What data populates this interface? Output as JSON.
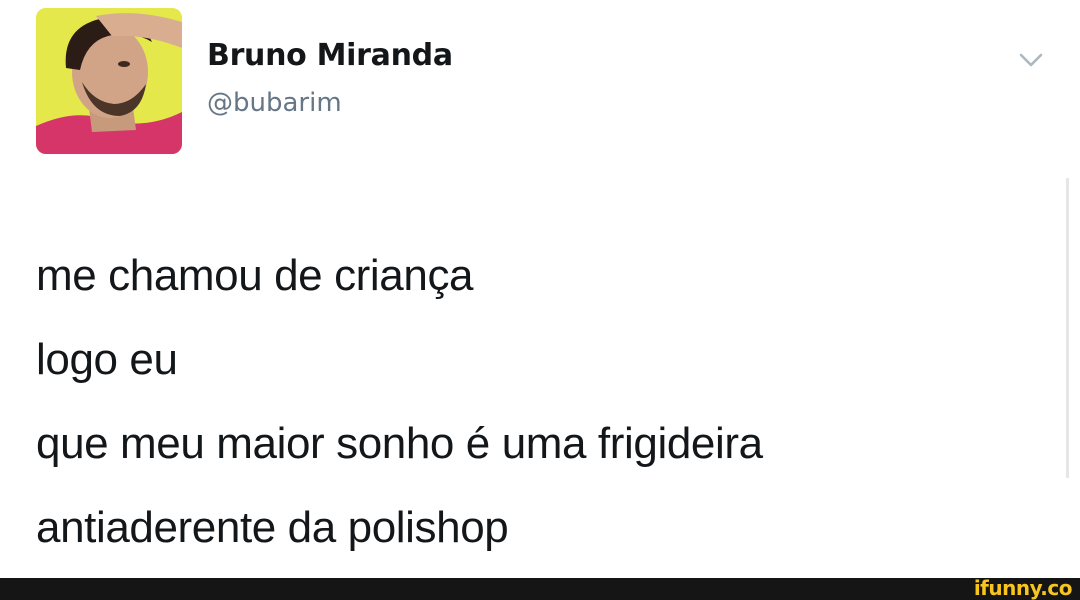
{
  "tweet": {
    "author_name": "Bruno Miranda",
    "author_handle": "@bubarim",
    "lines": [
      "me chamou de criança",
      "logo eu",
      "que meu maior sonho é uma frigideira",
      "antiaderente da polishop"
    ],
    "menu_icon": "chevron-down-icon"
  },
  "watermark": {
    "text": "ifunny.co"
  },
  "colors": {
    "name": "#14171a",
    "handle": "#657786",
    "avatar_background": "#e4e84a",
    "footer": "#151515",
    "watermark": "#f7c51d"
  }
}
